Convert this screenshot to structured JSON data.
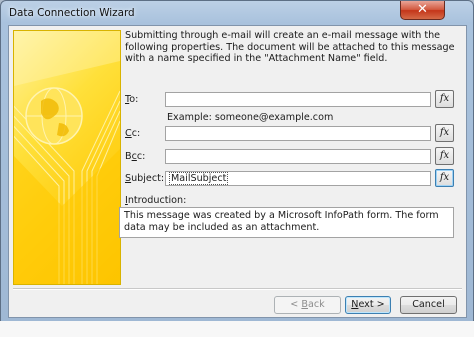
{
  "window": {
    "title": "Data Connection Wizard",
    "close_glyph": "✕"
  },
  "description": "Submitting through e-mail will create an e-mail message with the following properties. The document will be attached to this message with a name specified in the \"Attachment Name\" field.",
  "fields": {
    "to": {
      "label_key": "T",
      "label_rest": "o:",
      "value": "",
      "example": "Example: someone@example.com"
    },
    "cc": {
      "label_key": "C",
      "label_rest": "c:",
      "value": ""
    },
    "bcc": {
      "label_pre": "B",
      "label_key": "c",
      "label_rest": "c:",
      "value": ""
    },
    "subject": {
      "label_key": "S",
      "label_rest": "ubject:",
      "value": "MailSubject"
    }
  },
  "formula_button_label": "fx",
  "introduction": {
    "label_key": "I",
    "label_rest": "ntroduction:",
    "value": "This message was created by a Microsoft InfoPath form. The form data may be included as an attachment."
  },
  "buttons": {
    "back": {
      "prefix": "< ",
      "key": "B",
      "rest": "ack"
    },
    "next": {
      "key": "N",
      "rest": "ext >"
    },
    "cancel": "Cancel"
  },
  "colors": {
    "art_yellow": "#ffd21a",
    "close_red": "#c43519",
    "focus_blue": "#3c7fb1"
  },
  "art_icon": "globe-icon"
}
